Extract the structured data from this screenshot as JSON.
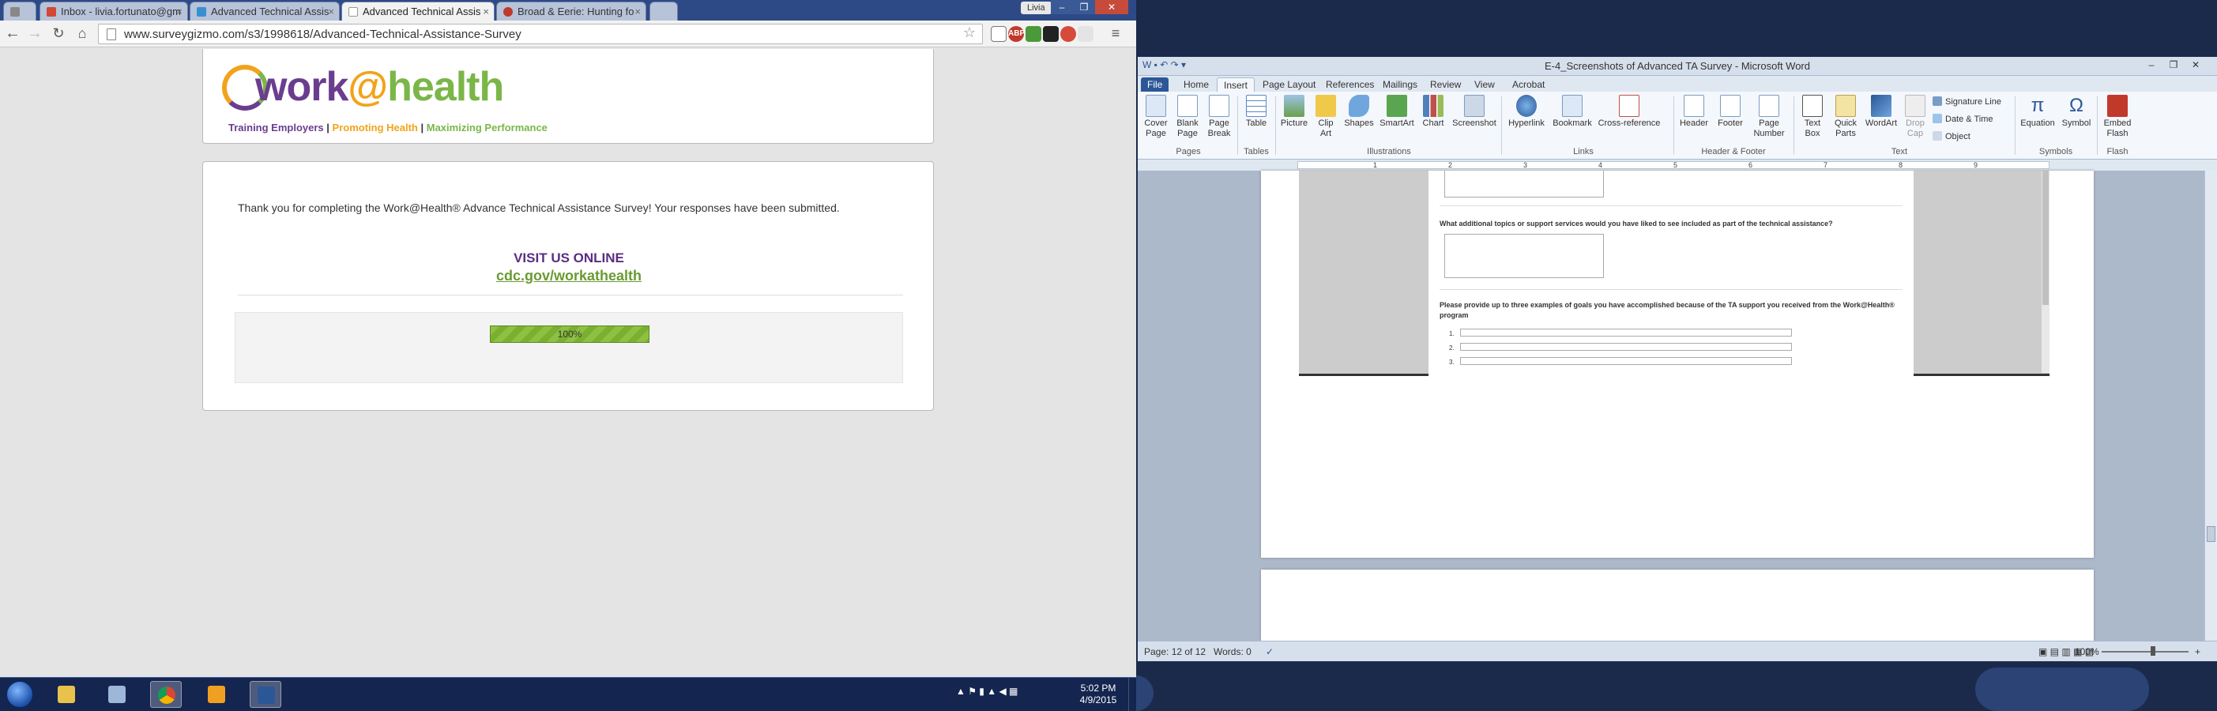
{
  "chrome": {
    "tabs": [
      {
        "label": "",
        "active": false
      },
      {
        "label": "Inbox - livia.fortunato@gm",
        "active": false
      },
      {
        "label": "Advanced Technical Assis",
        "active": false
      },
      {
        "label": "Advanced Technical Assis",
        "active": true
      },
      {
        "label": "Broad & Eerie: Hunting fo",
        "active": false
      }
    ],
    "user": "Livia",
    "url": "www.surveygizmo.com/s3/1998618/Advanced-Technical-Assistance-Survey"
  },
  "survey": {
    "logo": {
      "work": "work",
      "at": "@",
      "health": "health"
    },
    "tagline": {
      "part1": "Training Employers",
      "sep": " | ",
      "part2": "Promoting Health",
      "part3": "Maximizing Performance"
    },
    "thank_you": "Thank you for completing the Work@Health® Advance Technical Assistance Survey! Your responses have been submitted.",
    "visit_heading": "VISIT US ONLINE",
    "link": "cdc.gov/workathealth",
    "progress": {
      "percent": 100,
      "label": "100%"
    }
  },
  "word": {
    "title": "E-4_Screenshots of Advanced TA Survey - Microsoft Word",
    "tabs": [
      "File",
      "Home",
      "Insert",
      "Page Layout",
      "References",
      "Mailings",
      "Review",
      "View",
      "Acrobat"
    ],
    "active_tab": "Insert",
    "ribbon": {
      "buttons": [
        {
          "label": "Cover\nPage"
        },
        {
          "label": "Blank\nPage"
        },
        {
          "label": "Page\nBreak"
        },
        {
          "label": "Table"
        },
        {
          "label": "Picture"
        },
        {
          "label": "Clip\nArt"
        },
        {
          "label": "Shapes"
        },
        {
          "label": "SmartArt"
        },
        {
          "label": "Chart"
        },
        {
          "label": "Screenshot"
        },
        {
          "label": "Hyperlink"
        },
        {
          "label": "Bookmark"
        },
        {
          "label": "Cross-reference"
        },
        {
          "label": "Header"
        },
        {
          "label": "Footer"
        },
        {
          "label": "Page\nNumber"
        },
        {
          "label": "Text\nBox"
        },
        {
          "label": "Quick\nParts"
        },
        {
          "label": "WordArt"
        },
        {
          "label": "Drop\nCap"
        },
        {
          "label": "Equation"
        },
        {
          "label": "Symbol"
        },
        {
          "label": "Embed\nFlash"
        }
      ],
      "small": [
        "Signature Line",
        "Date & Time",
        "Object"
      ],
      "groups": [
        "Pages",
        "Tables",
        "Illustrations",
        "Links",
        "Header & Footer",
        "Text",
        "Symbols",
        "Flash"
      ]
    },
    "ruler_numbers": [
      "1",
      "2",
      "3",
      "4",
      "5",
      "6",
      "7",
      "8",
      "9"
    ],
    "doc": {
      "q1": "What additional topics or support services would you have liked to see included as part of the technical assistance?",
      "q2": "Please provide up to three examples of goals you have accomplished because of the TA support you received from the Work@Health® program",
      "nums": [
        "1.",
        "2.",
        "3."
      ]
    },
    "status": {
      "page": "Page: 12 of 12",
      "words": "Words: 0",
      "zoom": "100%"
    }
  },
  "taskbar": {
    "clock_time": "5:02 PM",
    "clock_date": "4/9/2015"
  },
  "colors": {
    "purple": "#6a3d8e",
    "orange": "#f2a31b",
    "green": "#7ab648",
    "word_blue": "#2b5797"
  }
}
